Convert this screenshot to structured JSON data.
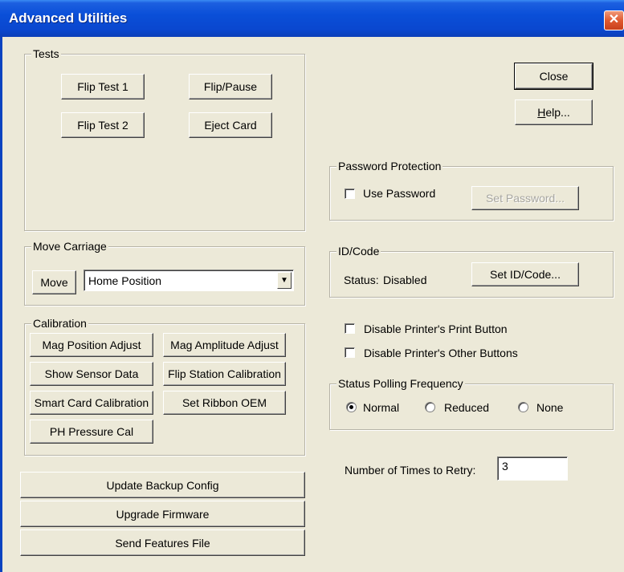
{
  "window": {
    "title": "Advanced Utilities",
    "close_glyph": "✕"
  },
  "tests": {
    "label": "Tests",
    "flip_test_1": "Flip Test 1",
    "flip_pause": "Flip/Pause",
    "flip_test_2": "Flip Test 2",
    "eject_card": "Eject Card"
  },
  "dialog_buttons": {
    "close": "Close",
    "help_accel": "H",
    "help_rest": "elp..."
  },
  "password": {
    "label": "Password Protection",
    "use_password": "Use Password",
    "use_password_checked": false,
    "set_password": "Set Password..."
  },
  "move_carriage": {
    "label": "Move Carriage",
    "move": "Move",
    "position_selected": "Home Position",
    "arrow_glyph": "▼"
  },
  "id_code": {
    "label": "ID/Code",
    "status_label": "Status:",
    "status_value": "Disabled",
    "set_id_code": "Set ID/Code..."
  },
  "options": {
    "disable_print_button": "Disable Printer's Print Button",
    "disable_other_buttons": "Disable Printer's Other Buttons"
  },
  "calibration": {
    "label": "Calibration",
    "mag_position_adjust": "Mag Position Adjust",
    "mag_amplitude_adjust": "Mag Amplitude Adjust",
    "show_sensor_data": "Show Sensor Data",
    "flip_station_calibration": "Flip Station Calibration",
    "smart_card_calibration": "Smart Card Calibration",
    "set_ribbon_oem": "Set Ribbon OEM",
    "ph_pressure_cal": "PH Pressure Cal"
  },
  "status_polling": {
    "label": "Status Polling Frequency",
    "normal": "Normal",
    "reduced": "Reduced",
    "none": "None",
    "selected": "Normal"
  },
  "retry": {
    "label": "Number of Times to Retry:",
    "value": "3"
  },
  "bottom_buttons": {
    "update_backup_config": "Update Backup Config",
    "upgrade_firmware": "Upgrade Firmware",
    "send_features_file": "Send Features File"
  }
}
